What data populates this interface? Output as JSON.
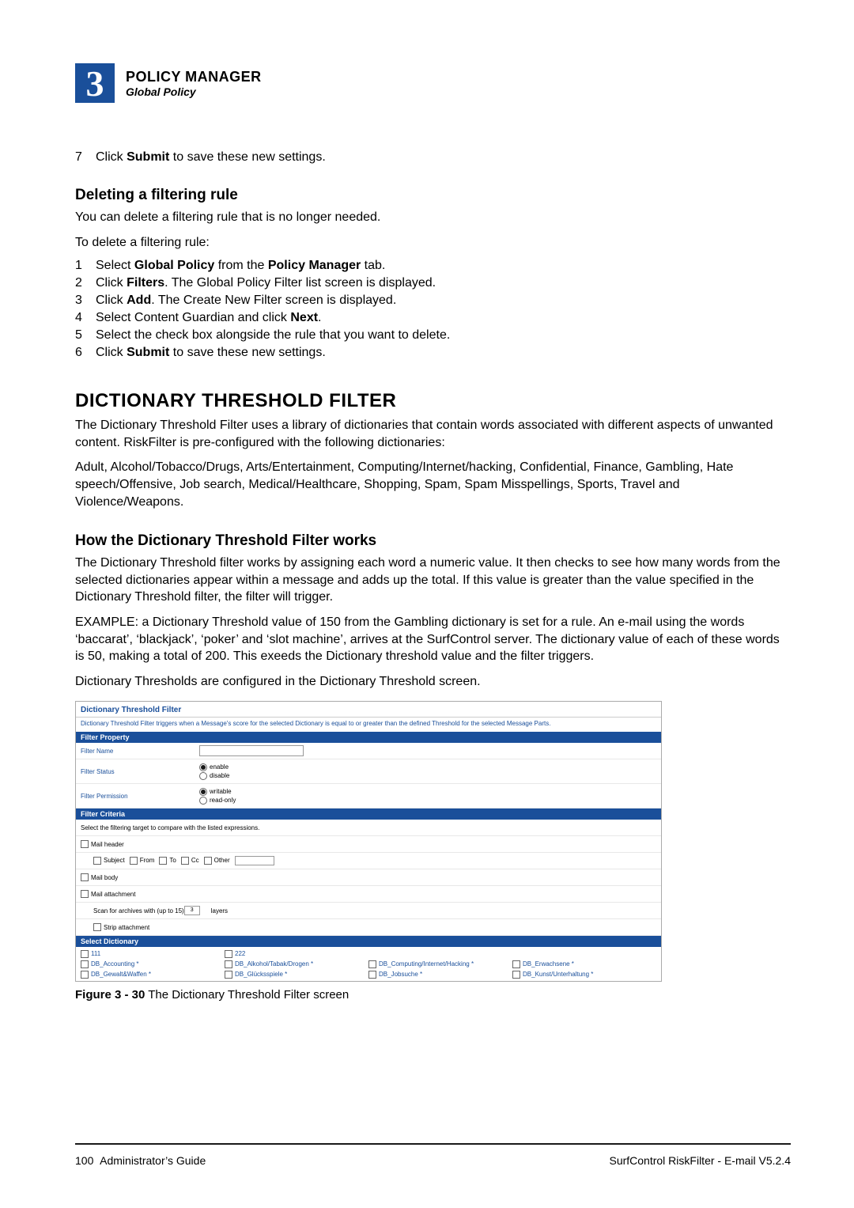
{
  "header": {
    "chapter": "3",
    "title": "POLICY MANAGER",
    "subtitle": "Global Policy"
  },
  "intro_step": {
    "num": "7",
    "pre": "Click ",
    "bold": "Submit",
    "post": " to save these new settings."
  },
  "del_heading": "Deleting a filtering rule",
  "del_p1": "You can delete a filtering rule that is no longer needed.",
  "del_p2": "To delete a filtering rule:",
  "del_steps": [
    {
      "num": "1",
      "parts": [
        "Select ",
        "Global Policy",
        " from the ",
        "Policy Manager",
        " tab."
      ]
    },
    {
      "num": "2",
      "parts": [
        "Click ",
        "Filters",
        ". The Global Policy Filter list screen is displayed."
      ]
    },
    {
      "num": "3",
      "parts": [
        "Click ",
        "Add",
        ". The Create New Filter screen is displayed."
      ]
    },
    {
      "num": "4",
      "parts": [
        "Select Content Guardian and click ",
        "Next",
        "."
      ]
    },
    {
      "num": "5",
      "parts": [
        "Select the check box alongside the rule that you want to delete."
      ]
    },
    {
      "num": "6",
      "parts": [
        "Click ",
        "Submit",
        " to save these new settings."
      ]
    }
  ],
  "h2_dict": "DICTIONARY THRESHOLD FILTER",
  "dict_p1": "The Dictionary Threshold Filter uses a library of dictionaries that contain words associated with different aspects of unwanted content. RiskFilter is pre-configured with the following dictionaries:",
  "dict_p2": "Adult, Alcohol/Tobacco/Drugs, Arts/Entertainment, Computing/Internet/hacking, Confidential, Finance, Gambling, Hate speech/Offensive, Job search, Medical/Healthcare, Shopping, Spam, Spam Misspellings, Sports, Travel and Violence/Weapons.",
  "how_heading": "How the Dictionary Threshold Filter works",
  "how_p1": "The Dictionary Threshold filter works by assigning each word a numeric value. It then checks to see how many words from the selected dictionaries appear within a message and adds up the total. If this value is greater than the value specified in the Dictionary Threshold filter, the filter will trigger.",
  "how_p2": "EXAMPLE: a Dictionary Threshold value of 150 from the Gambling dictionary is set for a rule. An e-mail using the words ‘baccarat’, ‘blackjack’, ‘poker’ and ‘slot machine’, arrives at the SurfControl server. The dictionary value of each of these words is 50, making a total of 200. This exeeds the Dictionary threshold value and the filter triggers.",
  "how_p3": "Dictionary Thresholds are configured in the Dictionary Threshold screen.",
  "screenshot": {
    "title": "Dictionary Threshold Filter",
    "desc": "Dictionary Threshold Filter triggers when a Message's score for the selected Dictionary is equal to or greater than the defined Threshold for the selected Message Parts.",
    "sec1": "Filter Property",
    "filterName": "Filter Name",
    "filterStatus": "Filter Status",
    "enable": "enable",
    "disable": "disable",
    "filterPerm": "Filter Permission",
    "writable": "writable",
    "readonly": "read-only",
    "sec2": "Filter Criteria",
    "criteriaDesc": "Select the filtering target to compare with the listed expressions.",
    "mailHeader": "Mail header",
    "subj": "Subject",
    "from": "From",
    "to": "To",
    "cc": "Cc",
    "other": "Other",
    "mailBody": "Mail body",
    "mailAtt": "Mail attachment",
    "scan_pre": "Scan for archives with (up to 15) ",
    "scan_val": "3",
    "scan_post": " layers",
    "strip": "Strip attachment",
    "sec3": "Select Dictionary",
    "dicts": {
      "c1": [
        "111",
        "DB_Accounting *",
        "DB_Gewalt&Waffen *"
      ],
      "c2": [
        "222",
        "DB_Alkohol/Tabak/Drogen *",
        "DB_Glücksspiele *"
      ],
      "c3": [
        "DB_Computing/Internet/Hacking *",
        "DB_Jobsuche *"
      ],
      "c4": [
        "DB_Erwachsene *",
        "DB_Kunst/Unterhaltung *"
      ]
    }
  },
  "figcap_bold": "Figure 3 - 30",
  "figcap_rest": " The Dictionary Threshold Filter screen",
  "footer": {
    "left_page": "100",
    "left_label": "Administrator’s Guide",
    "right": "SurfControl RiskFilter - E-mail V5.2.4"
  }
}
